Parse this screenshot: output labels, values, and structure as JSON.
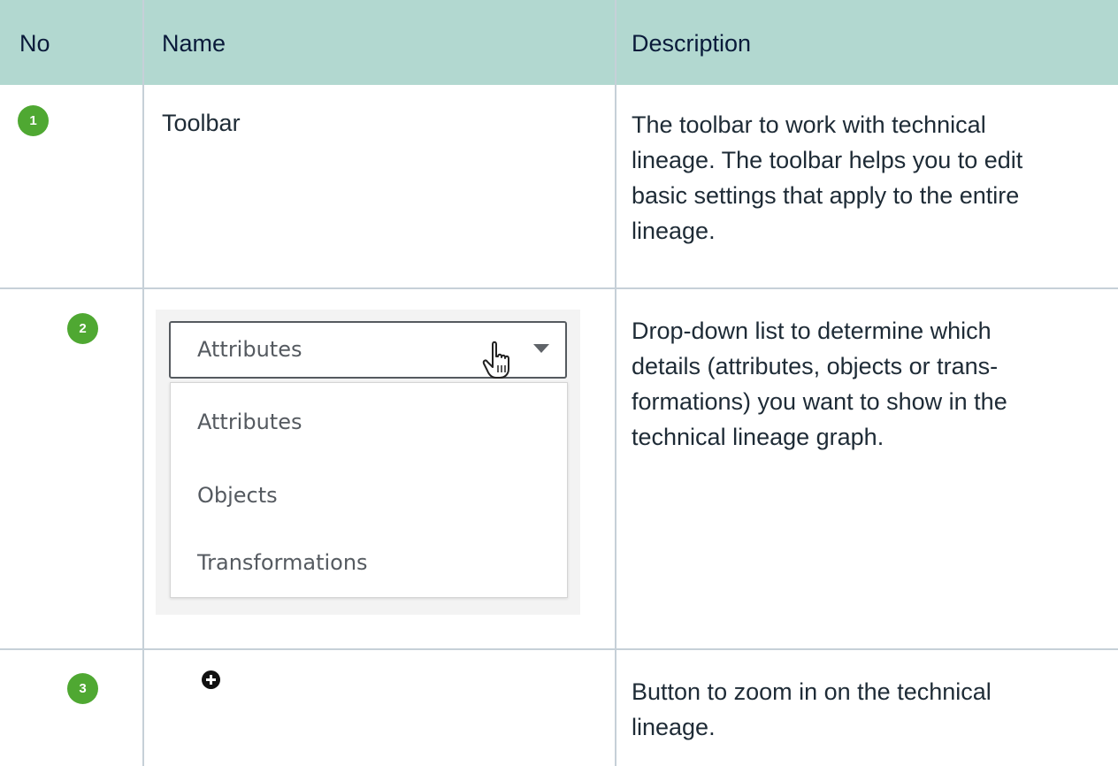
{
  "table": {
    "headers": {
      "no": "No",
      "name": "Name",
      "description": "Description"
    },
    "rows": [
      {
        "badge": "1",
        "name": "Toolbar",
        "description_lines": [
          "The toolbar to work with technical",
          "lineage. The toolbar helps you to edit",
          "basic settings that apply to the entire",
          "lineage."
        ]
      },
      {
        "badge": "2",
        "dropdown": {
          "selected": "Attributes",
          "options": [
            "Attributes",
            "Objects",
            "Transformations"
          ]
        },
        "description_lines": [
          "Drop-down list to determine which",
          "details (attributes, objects or trans-",
          "formations) you want to show in the",
          "technical lineage graph."
        ]
      },
      {
        "badge": "3",
        "icon": "zoom-in-plus-icon",
        "description_lines": [
          "Button to zoom in on the technical",
          "lineage."
        ]
      }
    ]
  },
  "colors": {
    "header_bg": "#b2d8d0",
    "badge_green": "#4fa832",
    "grid_line": "#c6d0d8"
  }
}
